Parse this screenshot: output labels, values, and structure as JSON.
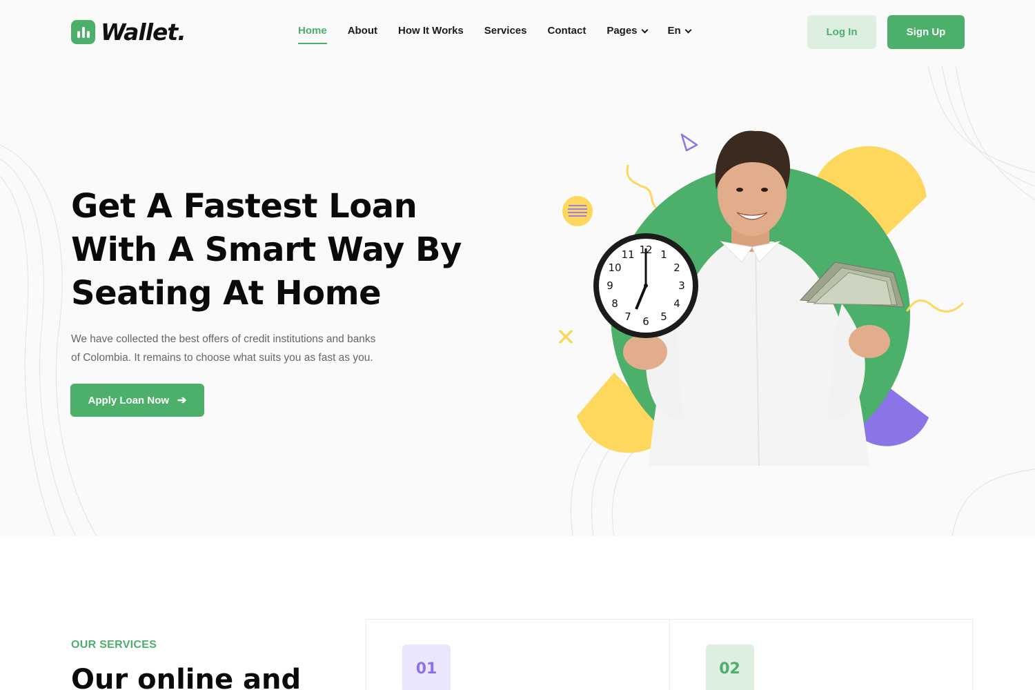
{
  "brand": {
    "name": "Wallet."
  },
  "nav": {
    "items": [
      {
        "label": "Home"
      },
      {
        "label": "About"
      },
      {
        "label": "How It Works"
      },
      {
        "label": "Services"
      },
      {
        "label": "Contact"
      },
      {
        "label": "Pages"
      },
      {
        "label": "En"
      }
    ]
  },
  "auth": {
    "login_label": "Log In",
    "signup_label": "Sign Up"
  },
  "hero": {
    "title_lines": [
      "Get A Fastest Loan",
      "With A Smart Way By",
      "Seating At Home"
    ],
    "description_lines": [
      "We have collected the best offers of credit institutions and banks",
      "of Colombia. It remains to choose what suits you as fast as you."
    ],
    "cta_label": "Apply Loan Now"
  },
  "services": {
    "eyebrow": "OUR SERVICES",
    "title": "Our online and",
    "cards": [
      {
        "number": "01"
      },
      {
        "number": "02"
      }
    ]
  },
  "clock": {
    "numbers": [
      "12",
      "1",
      "2",
      "3",
      "4",
      "5",
      "6",
      "7",
      "8",
      "9",
      "10",
      "11"
    ]
  },
  "colors": {
    "primary": "#4caf6a",
    "primary_light": "#dcefe0",
    "yellow": "#fdd85d",
    "purple": "#8b73e8",
    "hero_bg": "#fafafa"
  }
}
